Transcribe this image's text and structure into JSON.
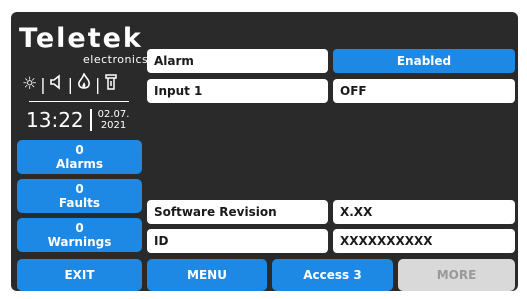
{
  "brand": {
    "name": "Teletek",
    "sub": "electronics"
  },
  "status_icons": [
    "sun-icon",
    "speaker-icon",
    "flame-icon",
    "tap-icon"
  ],
  "clock": {
    "time": "13:22",
    "date_line1": "02.07.",
    "date_line2": "2021"
  },
  "counters": [
    {
      "count": "0",
      "label": "Alarms"
    },
    {
      "count": "0",
      "label": "Faults"
    },
    {
      "count": "0",
      "label": "Warnings"
    }
  ],
  "rows": {
    "alarm": {
      "label": "Alarm",
      "value": "Enabled"
    },
    "input1": {
      "label": "Input 1",
      "value": "OFF"
    },
    "software": {
      "label": "Software Revision",
      "value": "X.XX"
    },
    "id": {
      "label": "ID",
      "value": "XXXXXXXXXX"
    }
  },
  "bottom": {
    "exit": "EXIT",
    "menu": "MENU",
    "access": "Access 3",
    "more": "MORE"
  },
  "colors": {
    "accent": "#1e88e5",
    "background": "#2a2a2a",
    "disabled": "#d9d9d9"
  }
}
